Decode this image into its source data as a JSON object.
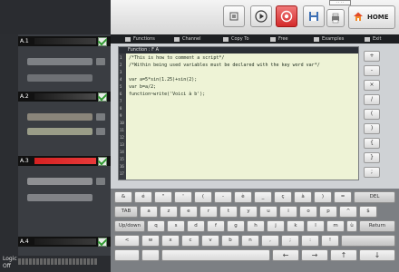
{
  "toolbar": {
    "home_label": "HOME",
    "mini_window_text": "· · · ·"
  },
  "menu": {
    "items": [
      "Functions",
      "Channel",
      "Copy To",
      "Free",
      "Examples",
      "Exit"
    ]
  },
  "channels": [
    {
      "label": "A.1"
    },
    {
      "label": "A.2"
    },
    {
      "label": "A.3"
    },
    {
      "label": "A.4"
    }
  ],
  "footer": {
    "logic_label": "Logic",
    "off_label": "Off"
  },
  "editor": {
    "title": "Function : F A",
    "lines": [
      "/*This is how to comment a script*/",
      "/*Within being used variables must be declared with the key word var*/",
      "var a=5*sin(1.25)+sin(2);",
      "var b=a/2;",
      "function~write('Voici à b');"
    ],
    "line_numbers": [
      "1",
      "2",
      "3",
      "4",
      "5",
      "6",
      "7",
      "8",
      "9",
      "10",
      "11",
      "12",
      "13",
      "14",
      "15",
      "16",
      "17"
    ]
  },
  "side_buttons": [
    "+",
    "-",
    "×",
    "/",
    "(",
    ")",
    "{",
    "}",
    ";"
  ],
  "keyboard": {
    "row1": [
      "&",
      "é",
      "\"",
      "'",
      "(",
      "-",
      "è",
      "_",
      "ç",
      "à",
      ")",
      "=",
      "DEL"
    ],
    "row2": [
      "TAB",
      "a",
      "z",
      "e",
      "r",
      "t",
      "y",
      "u",
      "i",
      "o",
      "p",
      "^",
      "$"
    ],
    "row3": [
      "Up/down",
      "q",
      "s",
      "d",
      "f",
      "g",
      "h",
      "j",
      "k",
      "l",
      "m",
      "ù",
      "Return"
    ],
    "row4": [
      "<",
      "w",
      "x",
      "c",
      "v",
      "b",
      "n",
      ",",
      ";",
      ":",
      "!"
    ],
    "row5": [
      "",
      "",
      "",
      "←",
      "→",
      "↑",
      "↓"
    ]
  }
}
